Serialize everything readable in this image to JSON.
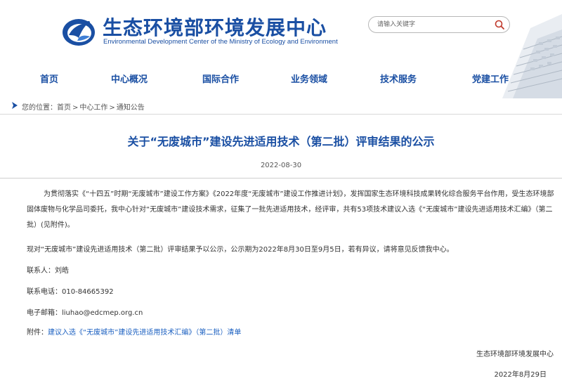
{
  "header": {
    "title": "生态环境部环境发展中心",
    "subtitle": "Environmental Development Center of the Ministry of Ecology and Environment",
    "search_placeholder": "请输入关键字",
    "logo_icon": "crane-logo-icon",
    "brand_color": "#1a4fa3"
  },
  "nav": {
    "items": [
      {
        "label": "首页"
      },
      {
        "label": "中心概况"
      },
      {
        "label": "国际合作"
      },
      {
        "label": "业务领域"
      },
      {
        "label": "技术服务"
      },
      {
        "label": "党建工作"
      }
    ]
  },
  "breadcrumb": {
    "prefix": "您的位置：",
    "items": [
      "首页",
      "中心工作",
      "通知公告"
    ],
    "separator": ">"
  },
  "article": {
    "title": "关于“无废城市”建设先进适用技术（第二批）评审结果的公示",
    "date": "2022-08-30",
    "paragraph1": "为贯彻落实《“十四五”时期“无废城市”建设工作方案》《2022年度“无废城市”建设工作推进计划》，发挥国家生态环境科技成果转化综合服务平台作用，受生态环境部固体废物与化学品司委托，我中心针对“无废城市”建设技术需求，征集了一批先进适用技术，经评审，共有53项技术建议入选《“无废城市”建设先进适用技术汇编》（第二批）(见附件)。",
    "paragraph2": "现对“无废城市”建设先进适用技术（第二批）评审结果予以公示，公示期为2022年8月30日至9月5日，若有异议，请将意见反馈我中心。",
    "contact_label": "联系人：",
    "contact_name": "刘皓",
    "phone_label": "联系电话：",
    "phone": "010-84665392",
    "email_label": "电子邮箱：",
    "email": "liuhao@edcmep.org.cn",
    "attachment_label": "附件：",
    "attachment_link": "建议入选《“无废城市”建设先进适用技术汇编》（第二批）清单",
    "signature_org": "生态环境部环境发展中心",
    "signature_date": "2022年8月29日"
  }
}
